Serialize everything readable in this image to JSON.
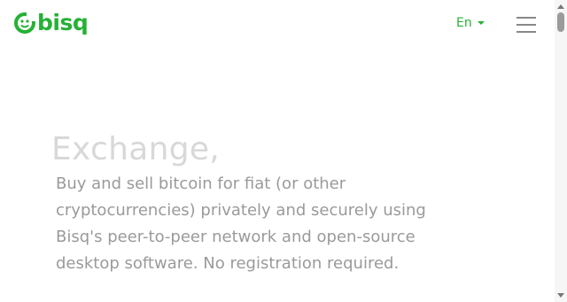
{
  "header": {
    "logo": {
      "icon": "bisq-logo-icon",
      "text": "bisq",
      "color": "#25b135"
    },
    "language": {
      "label": "En",
      "icon": "caret-down-icon"
    },
    "menu": {
      "icon": "hamburger-menu-icon"
    }
  },
  "hero": {
    "headline": "Exchange,",
    "lead": "Buy and sell bitcoin for fiat (or other cryptocurrencies) privately and securely using Bisq's peer-to-peer network and open-source desktop software. No registration required."
  },
  "colors": {
    "brand": "#25b135",
    "headline": "#d8d8d8",
    "lead": "#9a9a9a",
    "menu_icon": "#888888"
  }
}
